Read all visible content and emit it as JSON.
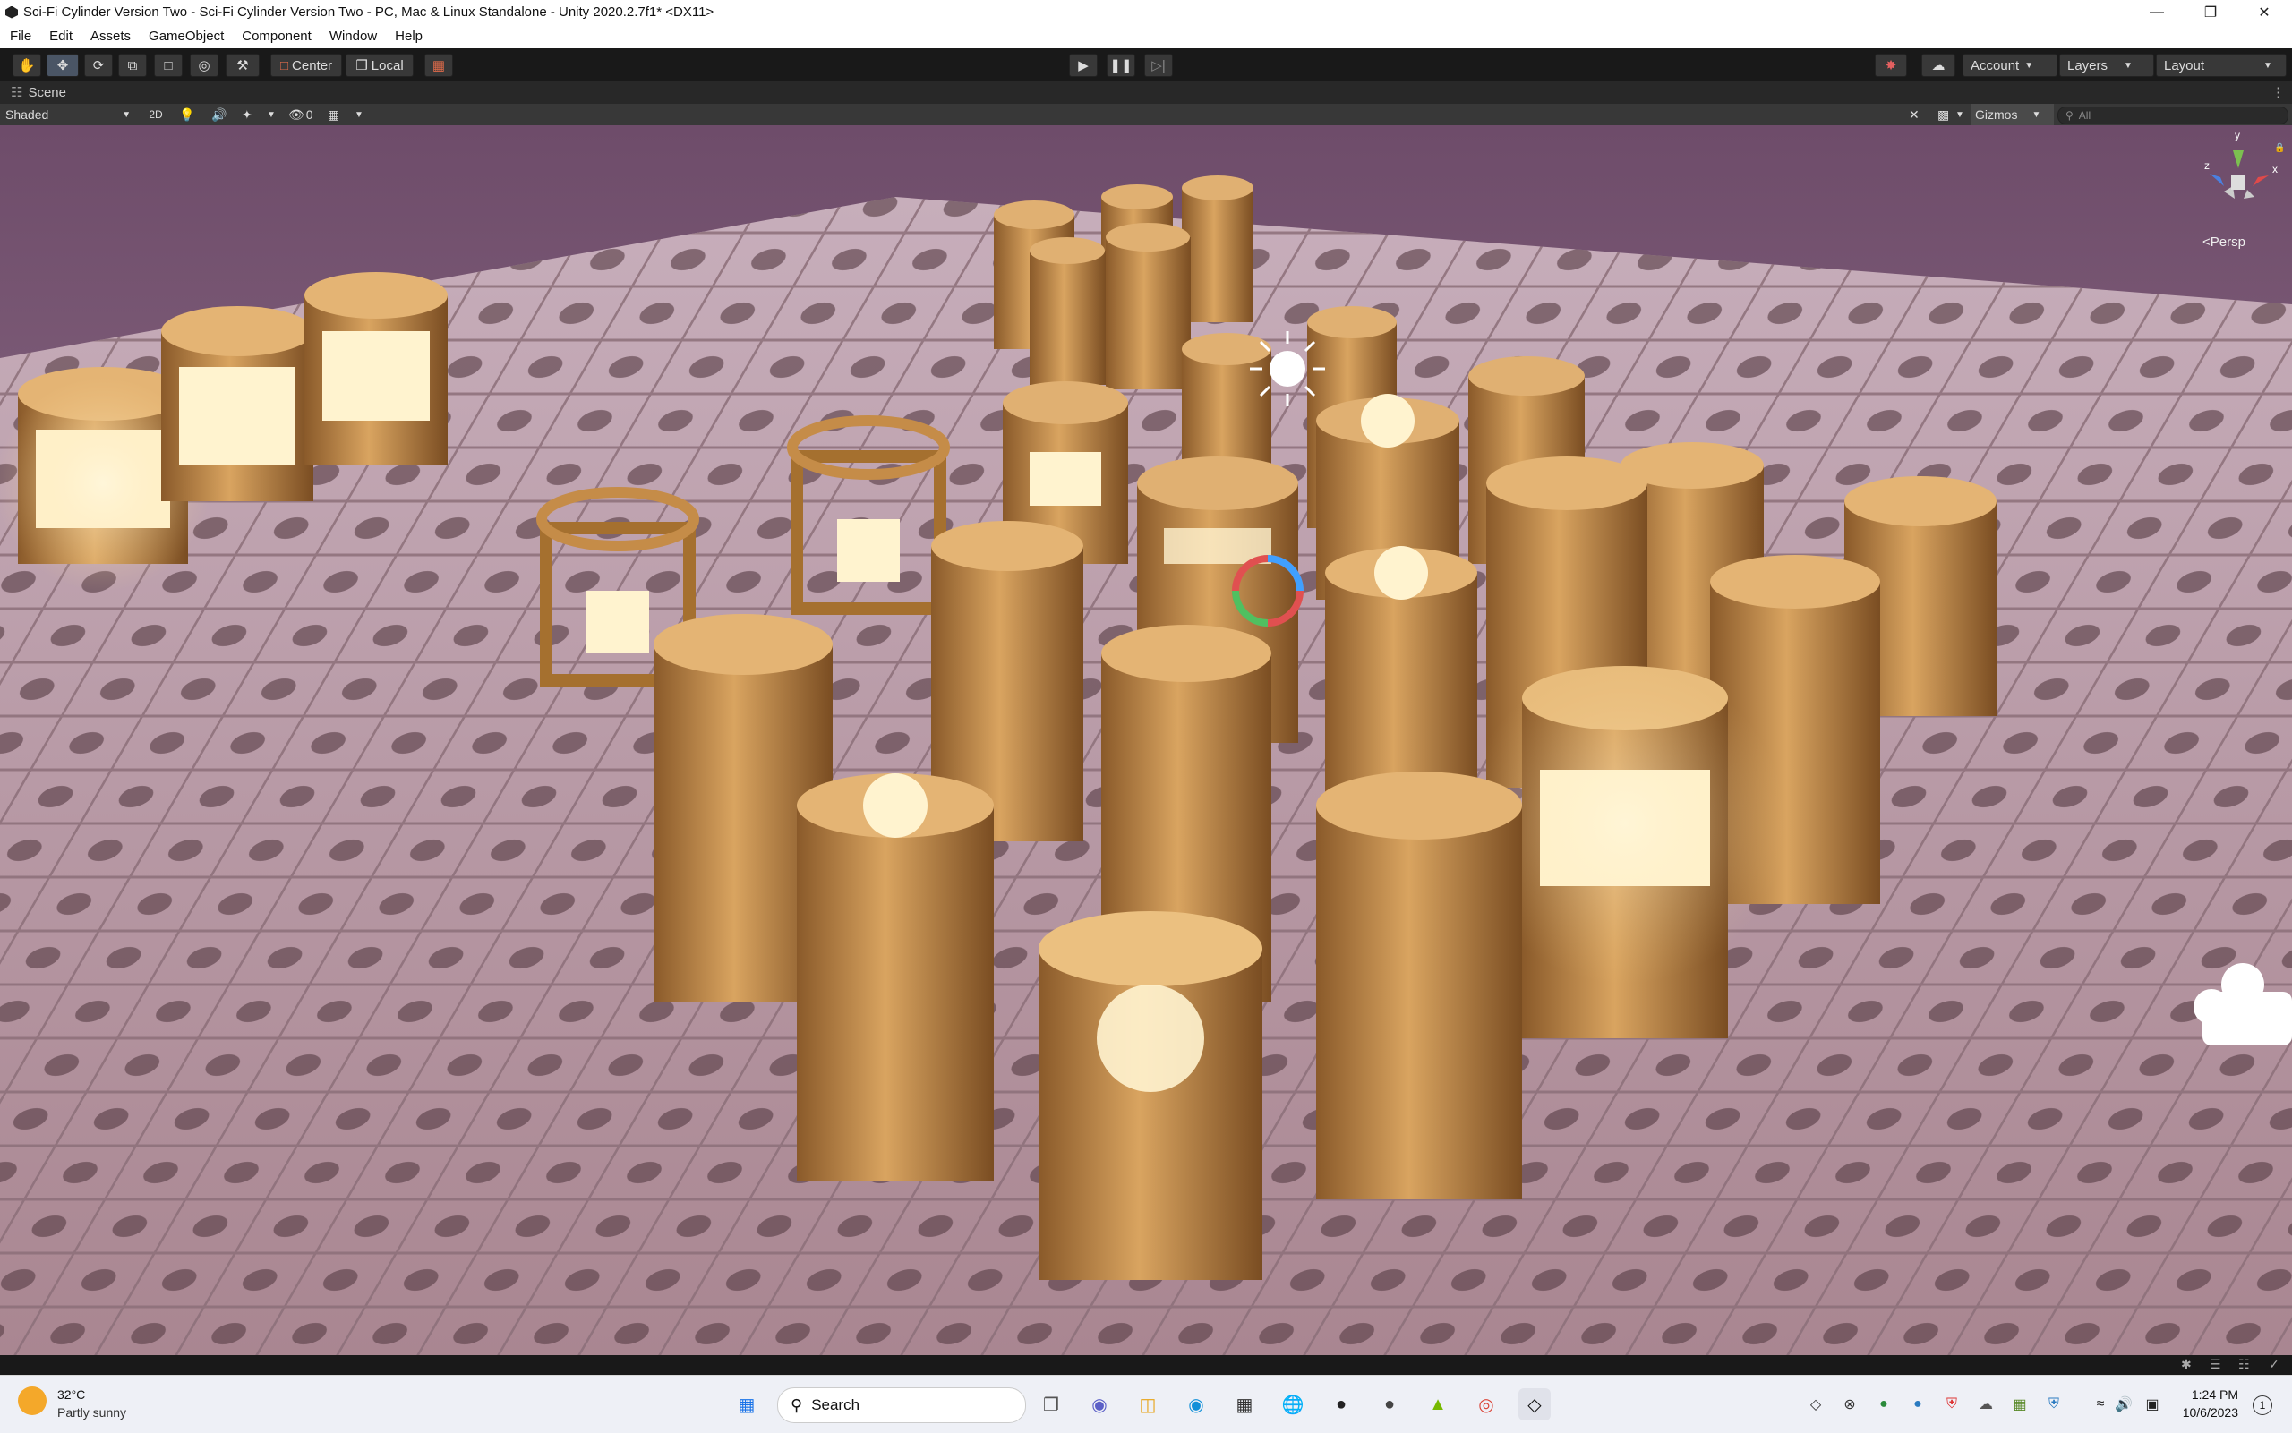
{
  "window": {
    "title": "Sci-Fi Cylinder Version Two - Sci-Fi Cylinder Version Two - PC, Mac & Linux Standalone - Unity 2020.2.7f1* <DX11>"
  },
  "menu": [
    "File",
    "Edit",
    "Assets",
    "GameObject",
    "Component",
    "Window",
    "Help"
  ],
  "toolbar": {
    "pivot_label": "Center",
    "space_label": "Local",
    "account_label": "Account",
    "layers_label": "Layers",
    "layout_label": "Layout"
  },
  "scene": {
    "tab_label": "Scene",
    "shading_mode": "Shaded",
    "mode_2d": "2D",
    "hidden_count": "0",
    "gizmos_label": "Gizmos",
    "search_placeholder": "All",
    "projection_label": "Persp",
    "axis_labels": {
      "y": "y",
      "x": "x",
      "z": "z"
    }
  },
  "taskbar": {
    "weather_temp": "32°C",
    "weather_desc": "Partly sunny",
    "search_label": "Search",
    "time": "1:24 PM",
    "date": "10/6/2023",
    "notification_count": "1"
  },
  "colors": {
    "editor_bg": "#191919",
    "scene_bar": "#383838",
    "sky": "#8a6a82",
    "floor": "#b38e9a",
    "cylinder": "#c08a4a",
    "glow": "#fff1c8",
    "taskbar_bg": "#eef0f6"
  }
}
